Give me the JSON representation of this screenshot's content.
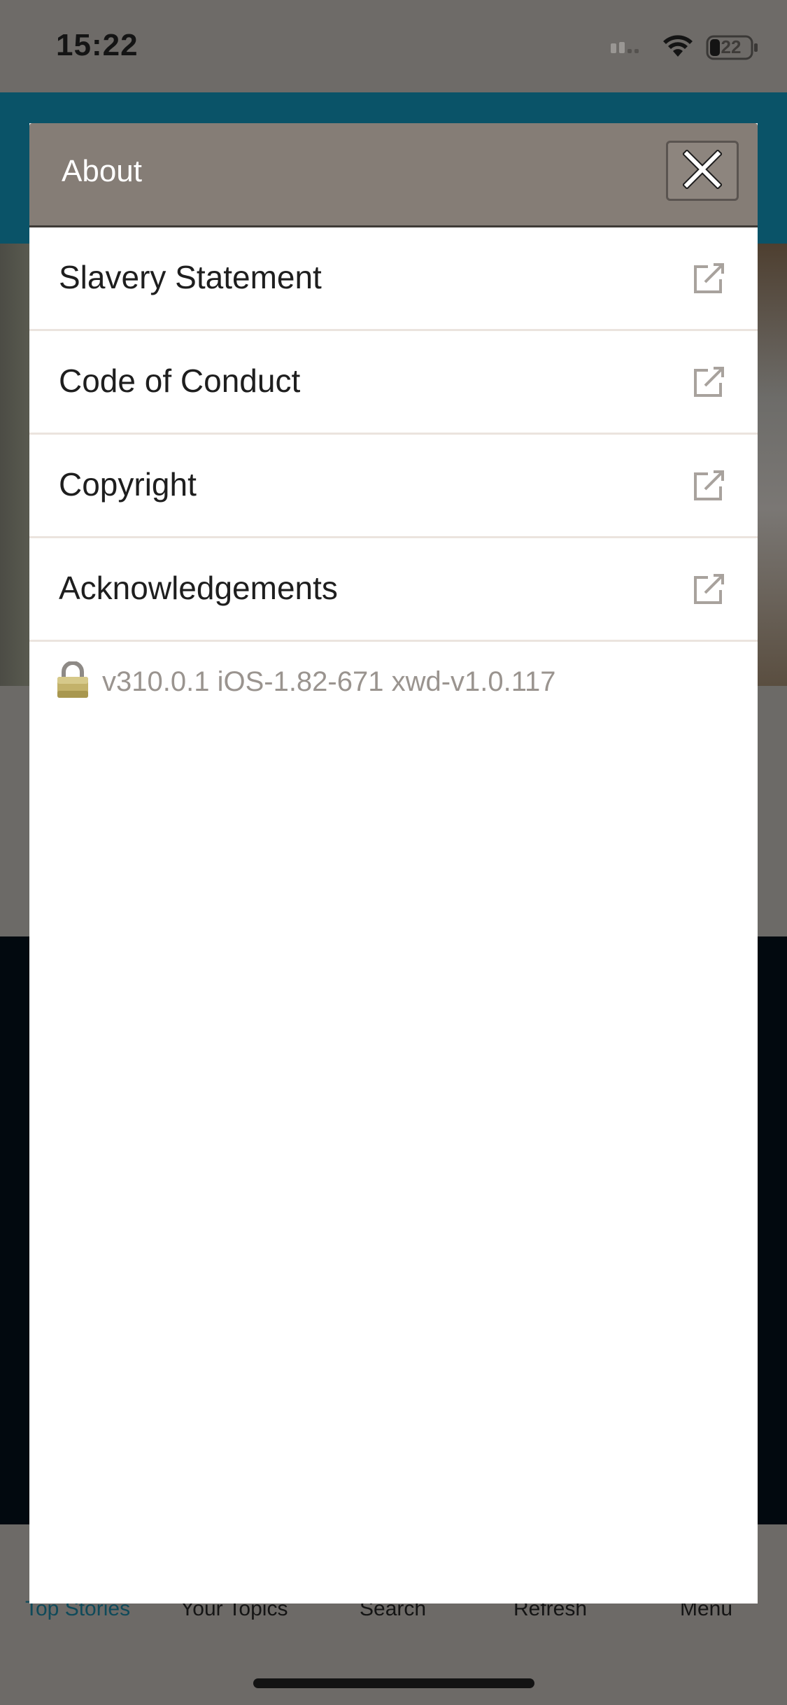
{
  "status_bar": {
    "time": "15:22",
    "battery": "22"
  },
  "modal": {
    "title": "About",
    "items": [
      {
        "label": "Slavery Statement"
      },
      {
        "label": "Code of Conduct"
      },
      {
        "label": "Copyright"
      },
      {
        "label": "Acknowledgements"
      }
    ],
    "version": "v310.0.1 iOS-1.82-671 xwd-v1.0.117"
  },
  "tab_bar": {
    "tabs": [
      {
        "label": "Top Stories"
      },
      {
        "label": "Your Topics"
      },
      {
        "label": "Search"
      },
      {
        "label": "Refresh"
      },
      {
        "label": "Menu"
      }
    ]
  },
  "colors": {
    "modal_header": "#857d76",
    "overlay": "#6d6a67",
    "version_text": "#9a948f",
    "active_tab": "#0f4a5a"
  }
}
